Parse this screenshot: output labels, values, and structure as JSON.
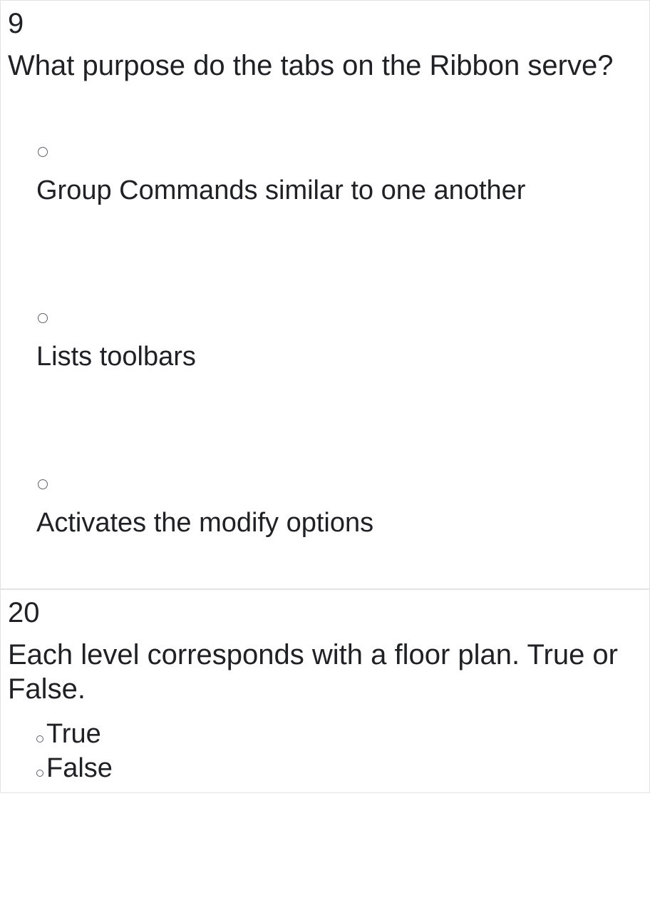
{
  "questions": [
    {
      "number": "9",
      "text": "What purpose do the tabs on the Ribbon serve?",
      "options": [
        "Group Commands similar to one another",
        "Lists toolbars",
        "Activates the modify options"
      ]
    },
    {
      "number": "20",
      "text": "Each level corresponds with a floor plan. True or False.",
      "options": [
        "True",
        "False"
      ]
    }
  ]
}
